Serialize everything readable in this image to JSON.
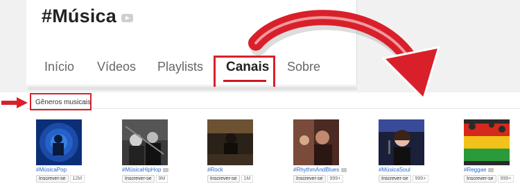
{
  "channel": {
    "title": "#Música",
    "badge_icon": "youtube-badge-icon"
  },
  "tabs": [
    {
      "label": "Início",
      "active": false
    },
    {
      "label": "Vídeos",
      "active": false
    },
    {
      "label": "Playlists",
      "active": false
    },
    {
      "label": "Canais",
      "active": true
    },
    {
      "label": "Sobre",
      "active": false
    }
  ],
  "section": {
    "title": "Gêneros musicais"
  },
  "annotations": {
    "highlight_color": "#d9202a",
    "accent_color": "#cc181e"
  },
  "channels": [
    {
      "name": "#MúsicaPop",
      "subscribe_label": "Inscrever-se",
      "subscribers": "12M"
    },
    {
      "name": "#MúsicaHipHop",
      "subscribe_label": "Inscrever-se",
      "subscribers": "9M"
    },
    {
      "name": "#Rock",
      "subscribe_label": "Inscrever-se",
      "subscribers": "1M"
    },
    {
      "name": "#RhythmAndBlues",
      "subscribe_label": "Inscrever-se",
      "subscribers": "999+"
    },
    {
      "name": "#MúsicaSoul",
      "subscribe_label": "Inscrever-se",
      "subscribers": "999+"
    },
    {
      "name": "#Reggae",
      "subscribe_label": "Inscrever-se",
      "subscribers": "999+"
    }
  ]
}
